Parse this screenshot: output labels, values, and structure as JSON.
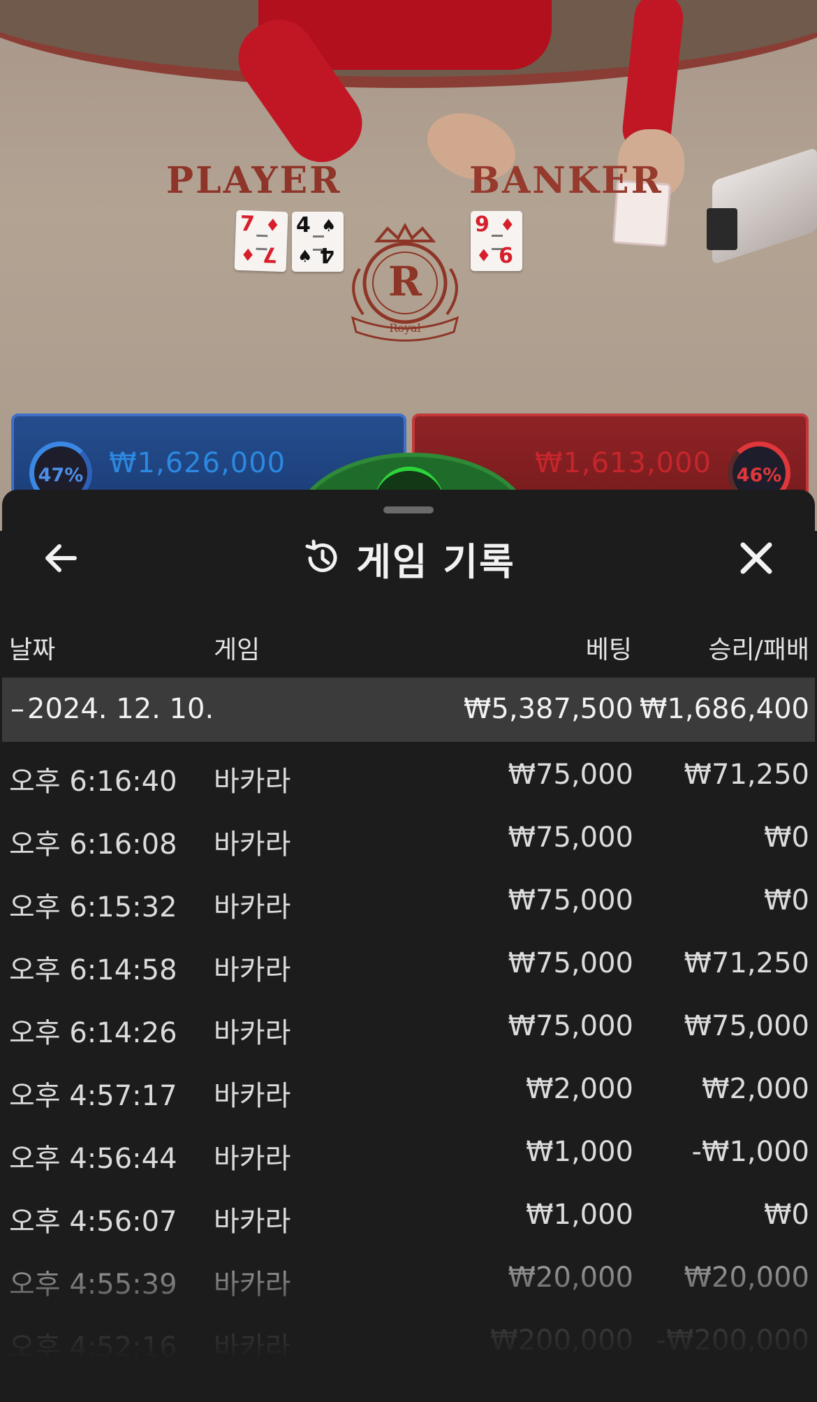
{
  "live_table": {
    "zone_labels": {
      "player": "PLAYER",
      "banker": "BANKER"
    },
    "crest_letter": "R",
    "crest_word": "Royal",
    "player_cards": [
      {
        "rank": "7",
        "suit": "♦",
        "color": "red"
      },
      {
        "rank": "4",
        "suit": "♠",
        "color": "black"
      }
    ],
    "banker_cards": [
      {
        "rank": "9",
        "suit": "♦",
        "color": "red"
      }
    ],
    "player_bet": {
      "percent": "47%",
      "amount": "₩1,626,000"
    },
    "banker_bet": {
      "percent": "46%",
      "amount": "₩1,613,000"
    },
    "colors": {
      "player": "#2c88e0",
      "banker": "#c5262b",
      "table_felt": "#b3a393"
    }
  },
  "history_sheet": {
    "title": "게임 기록",
    "icons": {
      "back": "arrow-left-icon",
      "title": "history-clock-icon",
      "close": "close-x-icon"
    },
    "columns": {
      "date": "날짜",
      "game": "게임",
      "bet": "베팅",
      "result": "승리/패배"
    },
    "group": {
      "toggle": "–",
      "date": "2024. 12. 10.",
      "total_bet": "₩5,387,500",
      "total_result": "₩1,686,400"
    },
    "rows": [
      {
        "time": "오후 6:16:40",
        "game": "바카라",
        "bet": "₩75,000",
        "result": "₩71,250"
      },
      {
        "time": "오후 6:16:08",
        "game": "바카라",
        "bet": "₩75,000",
        "result": "₩0"
      },
      {
        "time": "오후 6:15:32",
        "game": "바카라",
        "bet": "₩75,000",
        "result": "₩0"
      },
      {
        "time": "오후 6:14:58",
        "game": "바카라",
        "bet": "₩75,000",
        "result": "₩71,250"
      },
      {
        "time": "오후 6:14:26",
        "game": "바카라",
        "bet": "₩75,000",
        "result": "₩75,000"
      },
      {
        "time": "오후 4:57:17",
        "game": "바카라",
        "bet": "₩2,000",
        "result": "₩2,000"
      },
      {
        "time": "오후 4:56:44",
        "game": "바카라",
        "bet": "₩1,000",
        "result": "-₩1,000"
      },
      {
        "time": "오후 4:56:07",
        "game": "바카라",
        "bet": "₩1,000",
        "result": "₩0"
      },
      {
        "time": "오후 4:55:39",
        "game": "바카라",
        "bet": "₩20,000",
        "result": "₩20,000"
      },
      {
        "time": "오후 4:52:16",
        "game": "바카라",
        "bet": "₩200,000",
        "result": "-₩200,000"
      }
    ]
  }
}
